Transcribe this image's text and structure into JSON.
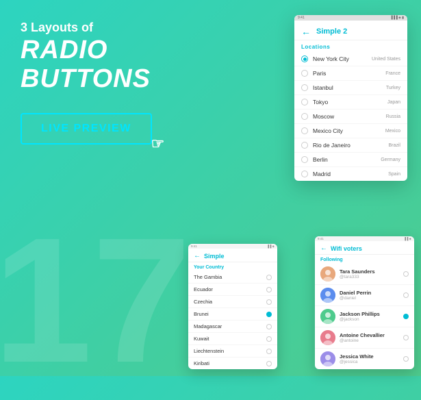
{
  "hero": {
    "label": "3 Layouts of",
    "title": "Radio Buttons",
    "button": "LIVE PREVIEW"
  },
  "watermark": "17",
  "mainPhone": {
    "back": "←",
    "title": "Simple 2",
    "sectionLabel": "Locations",
    "rows": [
      {
        "city": "New York City",
        "country": "United States",
        "selected": true
      },
      {
        "city": "Paris",
        "country": "France",
        "selected": false
      },
      {
        "city": "Istanbul",
        "country": "Turkey",
        "selected": false
      },
      {
        "city": "Tokyo",
        "country": "Japan",
        "selected": false
      },
      {
        "city": "Moscow",
        "country": "Russia",
        "selected": false
      },
      {
        "city": "Mexico City",
        "country": "Mexico",
        "selected": false
      },
      {
        "city": "Rio de Janeiro",
        "country": "Brazil",
        "selected": false
      },
      {
        "city": "Berlin",
        "country": "Germany",
        "selected": false
      },
      {
        "city": "Madrid",
        "country": "Spain",
        "selected": false
      }
    ]
  },
  "bottomLeftPhone": {
    "back": "←",
    "title": "Simple",
    "sectionLabel": "Your Country",
    "rows": [
      {
        "city": "The Gambia",
        "selected": false
      },
      {
        "city": "Ecuador",
        "selected": false
      },
      {
        "city": "Czechia",
        "selected": false
      },
      {
        "city": "Brunei",
        "selected": true
      },
      {
        "city": "Madagascar",
        "selected": false
      },
      {
        "city": "Kuwait",
        "selected": false
      },
      {
        "city": "Liechtenstein",
        "selected": false
      },
      {
        "city": "Kiribati",
        "selected": false
      }
    ]
  },
  "bottomRightPhone": {
    "back": "←",
    "title": "Wifi voters",
    "sectionLabel": "Following",
    "rows": [
      {
        "name": "Tara Saunders",
        "handle": "@tara333",
        "selected": false,
        "color": "#e8a87c"
      },
      {
        "name": "Daniel Perrin",
        "handle": "@daniel",
        "selected": false,
        "color": "#5b8dee"
      },
      {
        "name": "Jackson Phillips",
        "handle": "@jackson",
        "selected": true,
        "color": "#4ecb8d"
      },
      {
        "name": "Antoine Chevallier",
        "handle": "@antoine",
        "selected": false,
        "color": "#e87c8d"
      },
      {
        "name": "Jessica White",
        "handle": "@jessica",
        "selected": false,
        "color": "#9b8de8"
      }
    ]
  }
}
